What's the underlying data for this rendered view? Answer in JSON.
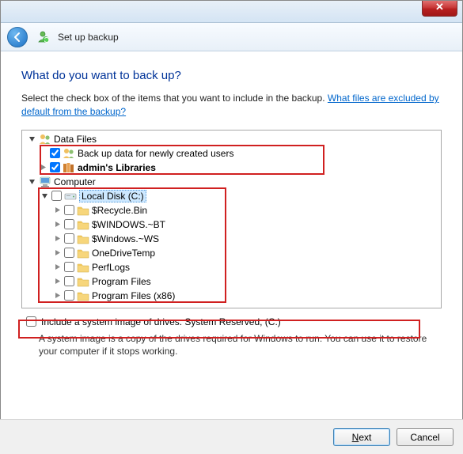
{
  "window": {
    "close_symbol": "✕"
  },
  "header": {
    "title": "Set up backup"
  },
  "main": {
    "heading": "What do you want to back up?",
    "instruction_pre": "Select the check box of the items that you want to include in the backup. ",
    "instruction_link": "What files are excluded by default from the backup?"
  },
  "tree": {
    "data_files_label": "Data Files",
    "backup_new_users_label": "Back up data for newly created users",
    "admin_libraries_label": "admin's Libraries",
    "computer_label": "Computer",
    "local_disk_label": "Local Disk (C:)",
    "folders": [
      "$Recycle.Bin",
      "$WINDOWS.~BT",
      "$Windows.~WS",
      "OneDriveTemp",
      "PerfLogs",
      "Program Files",
      "Program Files (x86)"
    ]
  },
  "sysimg": {
    "checkbox_label": "Include a system image of drives: System Reserved, (C:)",
    "description": "A system image is a copy of the drives required for Windows to run. You can use it to restore your computer if it stops working."
  },
  "footer": {
    "next_label": "Next",
    "cancel_label": "Cancel"
  }
}
